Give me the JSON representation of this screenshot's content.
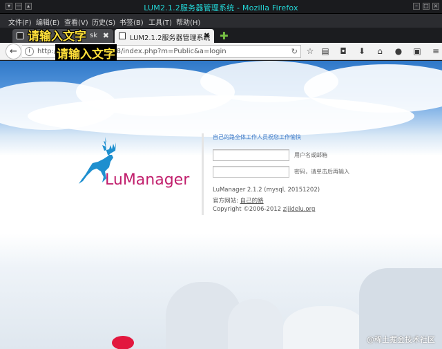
{
  "window": {
    "title": "LUM2.1.2服务器管理系统 - Mozilla Firefox"
  },
  "menu": {
    "items": [
      "文件(F)",
      "编辑(E)",
      "查看(V)",
      "历史(S)",
      "书签(B)",
      "工具(T)",
      "帮助(H)"
    ]
  },
  "tabs": {
    "inactive_label": "sk",
    "active_label": "LUM2.1.2服务器管理系统",
    "close_glyph": "✖",
    "new_tab_glyph": "✚"
  },
  "nav": {
    "url": "http://                k2skd.party:8888/index.php?m=Public&a=login"
  },
  "overlays": {
    "label1": "请输入文字",
    "label2": "请输入文字"
  },
  "login": {
    "brand": "LuManager",
    "heading": "自己的路全体工作人员祝您工作愉快",
    "username_hint": "用户名或邮箱",
    "password_hint": "密码，请单击后再输入",
    "version_line": "LuManager 2.1.2 (mysql, 20151202)",
    "site_label": "官方网站: ",
    "site_link": "自己的路",
    "copyright_label": "Copyright ©2006-2012 ",
    "copyright_link": "zijidelu.org"
  },
  "watermark": "@稀土掘金技术社区",
  "colors": {
    "accent_title": "#23d6d6",
    "brand_text": "#c11e6c",
    "deer_logo": "#1e8fcf",
    "heading_link": "#3a78c7",
    "overlay_text": "#ffe03a"
  }
}
